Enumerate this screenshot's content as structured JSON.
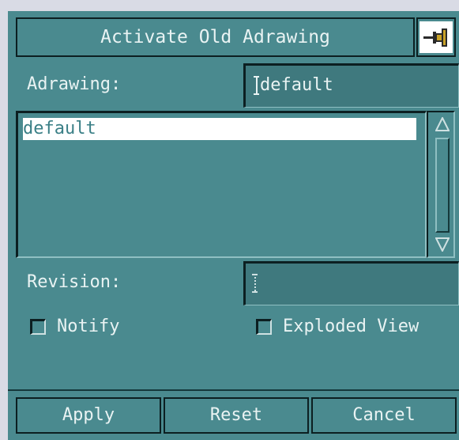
{
  "dialog": {
    "title": "Activate Old Adrawing",
    "pin_icon": "pushpin-icon"
  },
  "adrawing": {
    "label": "Adrawing:",
    "value": "default"
  },
  "list": {
    "items": [
      "default"
    ],
    "selected_index": 0
  },
  "revision": {
    "label": "Revision:",
    "value": ""
  },
  "options": {
    "notify_label": "Notify",
    "notify_checked": false,
    "exploded_label": "Exploded View",
    "exploded_checked": false
  },
  "buttons": {
    "apply": "Apply",
    "reset": "Reset",
    "cancel": "Cancel"
  },
  "colors": {
    "panel": "#4a8a8f",
    "text": "#e9f3f3",
    "selection_bg": "#ffffff",
    "selection_text": "#3a7f86"
  }
}
